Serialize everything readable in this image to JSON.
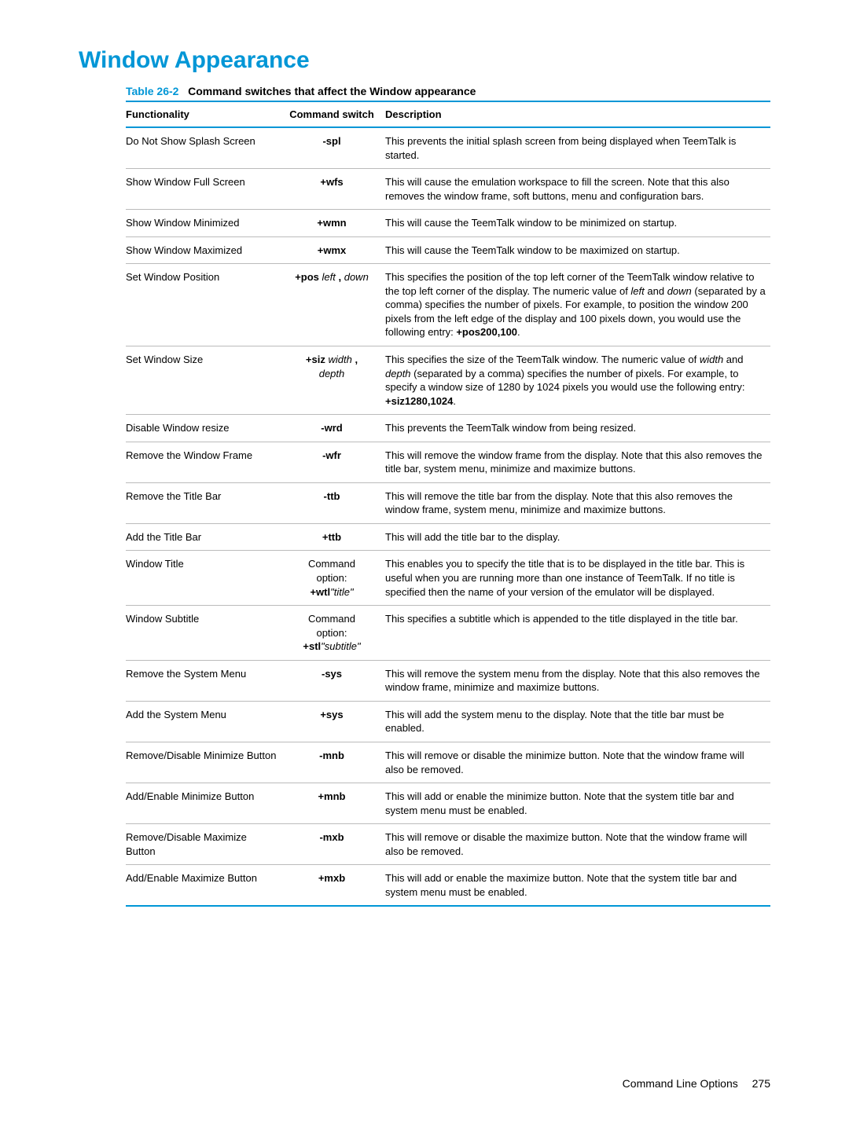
{
  "heading": "Window Appearance",
  "table_number": "Table 26-2",
  "table_caption": "Command switches that affect the Window appearance",
  "head": {
    "c1": "Functionality",
    "c2": "Command switch",
    "c3": "Description"
  },
  "rows": [
    {
      "f": "Do Not Show Splash Screen",
      "c_pre": "-spl",
      "c_ital": "",
      "c_post": "",
      "d": "This prevents the initial splash screen from being displayed when TeemTalk is started."
    },
    {
      "f": "Show Window Full Screen",
      "c_pre": "+wfs",
      "c_ital": "",
      "c_post": "",
      "d": "This will cause the emulation workspace to fill the screen. Note that this also removes the window frame, soft buttons, menu and configuration bars."
    },
    {
      "f": "Show Window Minimized",
      "c_pre": "+wmn",
      "c_ital": "",
      "c_post": "",
      "d": "This will cause the TeemTalk window to be minimized on startup."
    },
    {
      "f": "Show Window Maximized",
      "c_pre": "+wmx",
      "c_ital": "",
      "c_post": "",
      "d": "This will cause the TeemTalk window to be maximized on startup."
    },
    {
      "f": "Set Window Position",
      "c_pre": "+pos ",
      "c_ital": "left ",
      "c_post": ", ",
      "c_ital2": "down",
      "d_html": "This specifies the position of the top left corner of the TeemTalk window relative to the top left corner of the display. The numeric value of <span class='ital'>left</span> and <span class='ital'>down</span> (separated by a comma) specifies the number of pixels. For example, to position the window 200 pixels from the left edge of the display and 100 pixels down, you would use the following entry: <span class='bold'>+pos200,100</span>."
    },
    {
      "f": "Set Window Size",
      "c_pre": "+siz ",
      "c_ital": "width ",
      "c_post": ",",
      "c_br": true,
      "c_ital2": "depth",
      "d_html": "This specifies the size of the TeemTalk window. The numeric value of <span class='ital'>width</span> and <span class='ital'>depth</span> (separated by a comma) specifies the number of pixels. For example, to specify a window size of 1280 by 1024 pixels you would use the following entry: <span class='bold'>+siz1280,1024</span>."
    },
    {
      "f": "Disable Window resize",
      "c_pre": "-wrd",
      "c_ital": "",
      "c_post": "",
      "d": "This prevents the TeemTalk window from being resized."
    },
    {
      "f": "Remove the Window Frame",
      "c_pre": "-wfr",
      "c_ital": "",
      "c_post": "",
      "d": "This will remove the window frame from the display. Note that this also removes the title bar, system menu, minimize and maximize buttons."
    },
    {
      "f": "Remove the Title Bar",
      "c_pre": "-ttb",
      "c_ital": "",
      "c_post": "",
      "d": "This will remove the title bar from the display. Note that this also removes the window frame, system menu, minimize and maximize buttons."
    },
    {
      "f": "Add the Title Bar",
      "c_pre": "+ttb",
      "c_ital": "",
      "c_post": "",
      "d": "This will add the title bar to the display."
    },
    {
      "f": "Window Title",
      "c_norm1": "Command",
      "c_norm2": "option:",
      "c_pre": "+wtl",
      "c_ital": "\"title\"",
      "d": "This enables you to specify the title that is to be displayed in the title bar. This is useful when you are running more than one instance of TeemTalk. If no title is specified then the name of your version of the emulator will be displayed."
    },
    {
      "f": "Window Subtitle",
      "c_norm1": "Command",
      "c_norm2": "option:",
      "c_pre": "+stl",
      "c_ital": "\"subtitle\"",
      "d": "This specifies a subtitle which is appended to the title displayed in the title bar."
    },
    {
      "f": "Remove the System Menu",
      "c_pre": "-sys",
      "c_ital": "",
      "c_post": "",
      "d": "This will remove the system menu from the display. Note that this also removes the window frame, minimize and maximize buttons."
    },
    {
      "f": "Add the System Menu",
      "c_pre": "+sys",
      "c_ital": "",
      "c_post": "",
      "d": "This will add the system menu to the display. Note that the title bar must be enabled."
    },
    {
      "f": "Remove/Disable Minimize Button",
      "c_pre": "-mnb",
      "c_ital": "",
      "c_post": "",
      "d": "This will remove or disable the minimize button. Note that the window frame will also be removed."
    },
    {
      "f": "Add/Enable Minimize Button",
      "c_pre": "+mnb",
      "c_ital": "",
      "c_post": "",
      "d": "This will add or enable the minimize button. Note that the system title bar and system menu must be enabled."
    },
    {
      "f": "Remove/Disable Maximize Button",
      "c_pre": "-mxb",
      "c_ital": "",
      "c_post": "",
      "d": "This will remove or disable the maximize button. Note that the window frame will also be removed."
    },
    {
      "f": "Add/Enable Maximize Button",
      "c_pre": "+mxb",
      "c_ital": "",
      "c_post": "",
      "d": "This will add or enable the maximize button. Note that the system title bar and system menu must be enabled."
    }
  ],
  "footer_text": "Command Line Options",
  "page_number": "275"
}
